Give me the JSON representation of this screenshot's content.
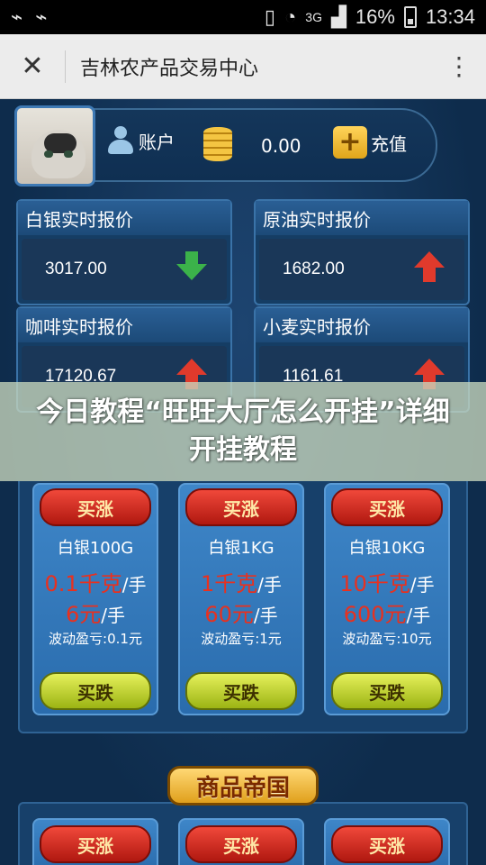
{
  "status_bar": {
    "time": "13:34",
    "battery": "16%",
    "network": "3G",
    "left_icons": [
      "usb-icon",
      "usb-icon"
    ],
    "right_icons": [
      "vibrate-icon",
      "wifi-icon",
      "signal-icon",
      "battery-icon"
    ]
  },
  "app_bar": {
    "title": "吉林农产品交易中心",
    "close_icon": "close-icon",
    "menu_icon": "more-vertical-icon"
  },
  "account": {
    "user_label": "账户",
    "balance": "0.00",
    "recharge_label": "充值"
  },
  "quotes": [
    {
      "title": "白银实时报价",
      "price": "3017.00",
      "direction": "down"
    },
    {
      "title": "原油实时报价",
      "price": "1682.00",
      "direction": "up"
    },
    {
      "title": "咖啡实时报价",
      "price": "17120.67",
      "direction": "up"
    },
    {
      "title": "小麦实时报价",
      "price": "1161.61",
      "direction": "up"
    }
  ],
  "banner": {
    "text": "今日教程“旺旺大厅怎么开挂”详细开挂教程"
  },
  "products": [
    {
      "buy_up": "买涨",
      "buy_down": "买跌",
      "name": "白银100G",
      "amount": "0.1千克",
      "per": "/手",
      "fee": "6元",
      "fee_per": "/手",
      "pnl": "波动盈亏:0.1元"
    },
    {
      "buy_up": "买涨",
      "buy_down": "买跌",
      "name": "白银1KG",
      "amount": "1千克",
      "per": "/手",
      "fee": "60元",
      "fee_per": "/手",
      "pnl": "波动盈亏:1元"
    },
    {
      "buy_up": "买涨",
      "buy_down": "买跌",
      "name": "白银10KG",
      "amount": "10千克",
      "per": "/手",
      "fee": "600元",
      "fee_per": "/手",
      "pnl": "波动盈亏:10元"
    }
  ],
  "section_title": "商品帝国",
  "bottom_products": [
    {
      "buy_up": "买涨"
    },
    {
      "buy_up": "买涨"
    },
    {
      "buy_up": "买涨"
    }
  ]
}
